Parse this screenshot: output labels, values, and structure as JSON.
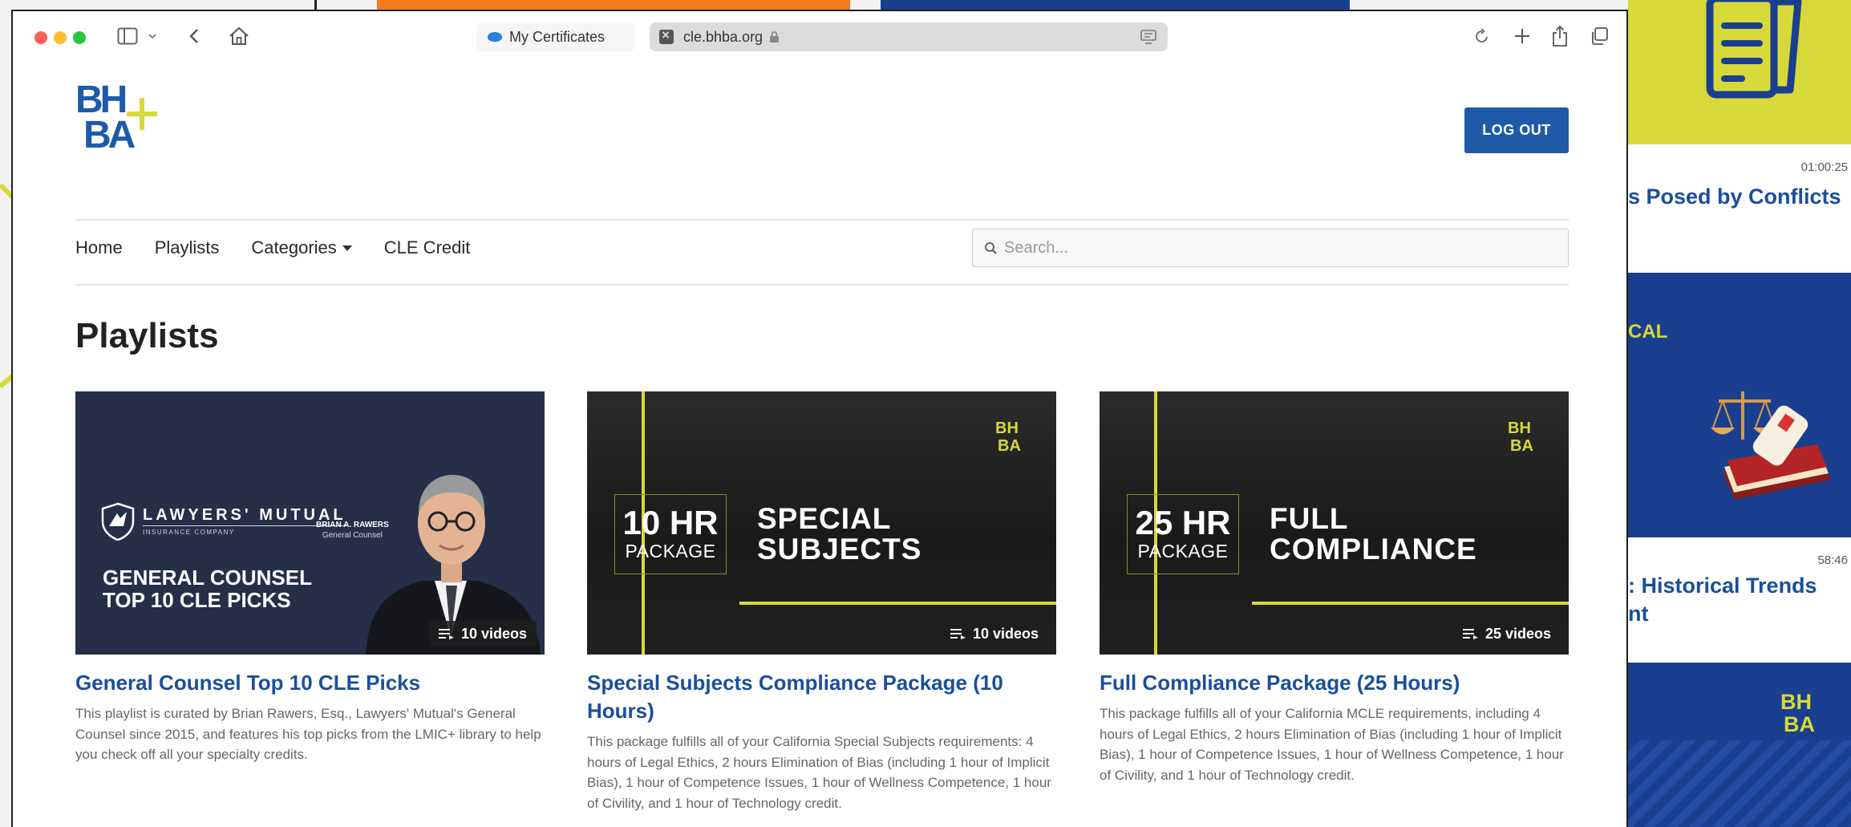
{
  "browser": {
    "tab_label": "My Certificates",
    "address": "cle.bhba.org"
  },
  "header": {
    "logout_label": "LOG OUT"
  },
  "nav": {
    "items": [
      {
        "label": "Home"
      },
      {
        "label": "Playlists"
      },
      {
        "label": "Categories"
      },
      {
        "label": "CLE Credit"
      }
    ],
    "search_placeholder": "Search..."
  },
  "page_title": "Playlists",
  "cards": [
    {
      "title": "General Counsel Top 10 CLE Picks",
      "description": "This playlist is curated by Brian Rawers, Esq., Lawyers' Mutual's General Counsel since 2015, and features his top picks from the LMIC+ library to help you check off all your specialty credits.",
      "video_count": "10 videos",
      "thumb": {
        "brand_big": "LAWYERS' MUTUAL",
        "brand_small": "INSURANCE COMPANY",
        "person_name": "BRIAN A. RAWERS",
        "person_role": "General Counsel",
        "headline_1": "GENERAL COUNSEL",
        "headline_2": "TOP 10 CLE PICKS"
      }
    },
    {
      "title": "Special Subjects Compliance Package (10 Hours)",
      "description": "This package fulfills all of your California Special Subjects requirements: 4 hours of Legal Ethics, 2 hours Elimination of Bias (including 1 hour of Implicit Bias), 1 hour of Competence Issues, 1 hour of Wellness Competence, 1 hour of Civility, and 1 hour of Technology credit.",
      "video_count": "10 videos",
      "thumb": {
        "hours": "10 HR",
        "package_word": "PACKAGE",
        "label_1": "SPECIAL",
        "label_2": "SUBJECTS"
      }
    },
    {
      "title": "Full Compliance Package (25 Hours)",
      "description": "This package fulfills all of your California MCLE requirements, including 4 hours of Legal Ethics, 2 hours Elimination of Bias (including 1 hour of Implicit Bias), 1 hour of Competence Issues, 1 hour of Wellness Competence, 1 hour of Civility, and 1 hour of Technology credit.",
      "video_count": "25 videos",
      "thumb": {
        "hours": "25 HR",
        "package_word": "PACKAGE",
        "label_1": "FULL",
        "label_2": "COMPLIANCE"
      }
    }
  ],
  "background": {
    "items": [
      {
        "time": "01:00:25",
        "title": "s Posed by Conflicts"
      },
      {
        "label": "CAL"
      },
      {
        "time": "58:46",
        "title_1": ": Historical Trends",
        "title_2": "nt"
      }
    ]
  },
  "colors": {
    "brand_blue": "#1e5aa8",
    "link_blue": "#1a4f9c",
    "accent_yellow": "#d7d93a",
    "navy": "#1a3f8f"
  }
}
